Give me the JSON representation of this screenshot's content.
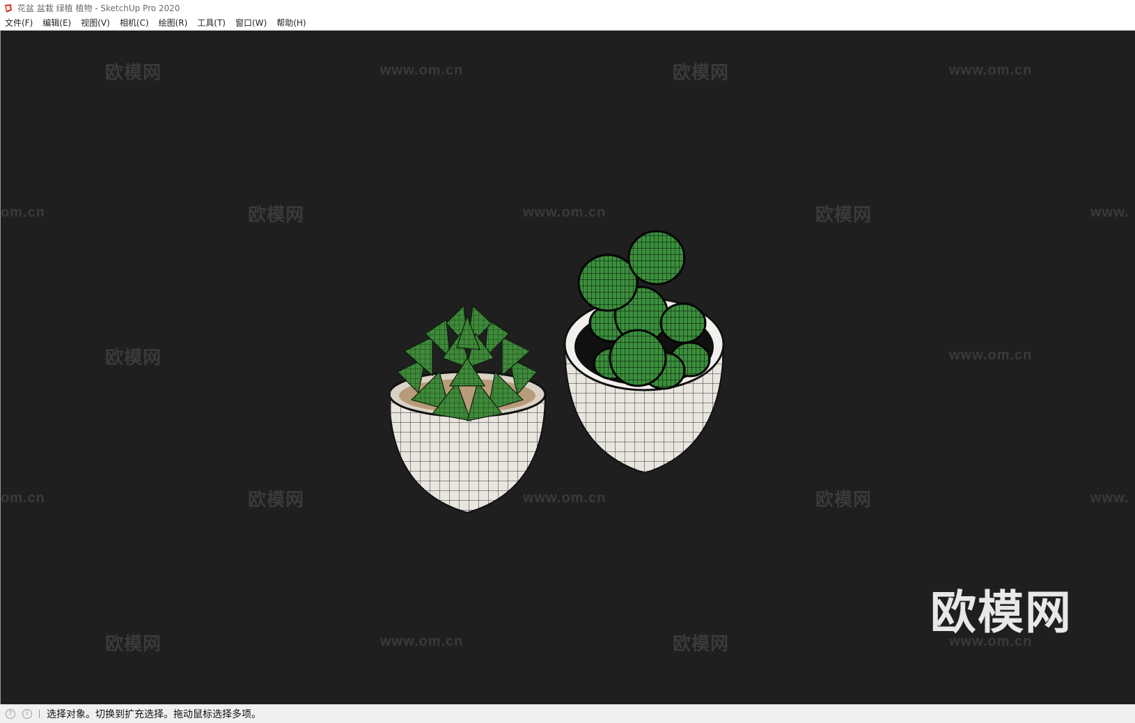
{
  "window": {
    "title": "花盆 盆栽 绿植 植物 - SketchUp Pro 2020"
  },
  "menu": {
    "items": [
      "文件(F)",
      "编辑(E)",
      "视图(V)",
      "相机(C)",
      "绘图(R)",
      "工具(T)",
      "窗口(W)",
      "帮助(H)"
    ]
  },
  "watermarks": {
    "logo_text": "欧模网",
    "url_text": "www.om.cn",
    "url_partial_left": "om.cn",
    "url_partial_right": "www."
  },
  "status": {
    "message": "选择对象。切换到扩充选择。拖动鼠标选择多项。"
  },
  "colors": {
    "viewport_bg": "#1f1f1f",
    "watermark": "#3a3a3a",
    "succulent_green": "#3f8a3a",
    "pot_white": "#e9e6e0"
  }
}
